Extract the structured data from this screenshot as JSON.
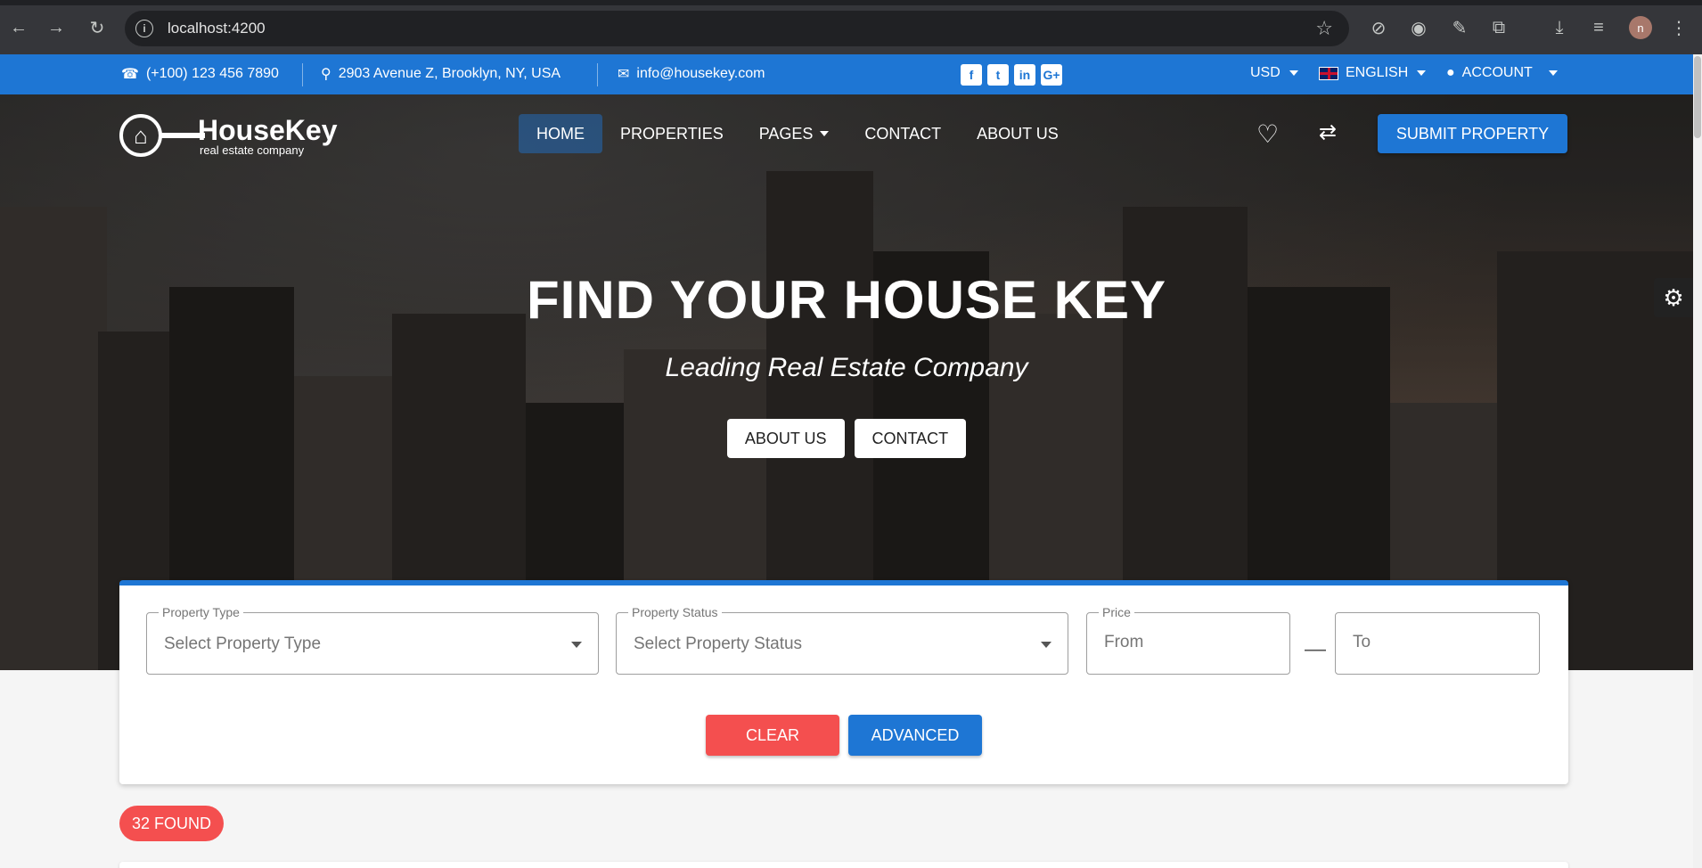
{
  "browser": {
    "url": "localhost:4200",
    "avatar_letter": "n",
    "icons": [
      "back-icon",
      "forward-icon",
      "reload-icon",
      "site-info-icon",
      "bookmark-star-icon",
      "extension-icon",
      "puzzle-icon",
      "download-icon",
      "media-icon",
      "menu-icon"
    ]
  },
  "topbar": {
    "phone": "(+100) 123 456 7890",
    "address": "2903 Avenue Z, Brooklyn, NY, USA",
    "email": "info@housekey.com",
    "social": [
      "f",
      "t",
      "in",
      "G+"
    ],
    "currency": "USD",
    "language": "ENGLISH",
    "account": "ACCOUNT"
  },
  "logo": {
    "name": "HouseKey",
    "tagline": "real estate company"
  },
  "nav": {
    "items": [
      "HOME",
      "PROPERTIES",
      "PAGES",
      "CONTACT",
      "ABOUT US"
    ],
    "active": "HOME",
    "submit": "SUBMIT PROPERTY"
  },
  "hero": {
    "title": "FIND YOUR HOUSE KEY",
    "subtitle": "Leading Real Estate Company",
    "buttons": [
      "ABOUT US",
      "CONTACT"
    ]
  },
  "search": {
    "property_type": {
      "label": "Property Type",
      "placeholder": "Select Property Type"
    },
    "property_status": {
      "label": "Property Status",
      "placeholder": "Select Property Status"
    },
    "price": {
      "label": "Price",
      "from": "From",
      "to": "To",
      "separator": "—"
    },
    "clear": "CLEAR",
    "advanced": "ADVANCED"
  },
  "results": {
    "found": "32 FOUND"
  },
  "colors": {
    "primary": "#1e76d4",
    "danger": "#f44f4f"
  }
}
